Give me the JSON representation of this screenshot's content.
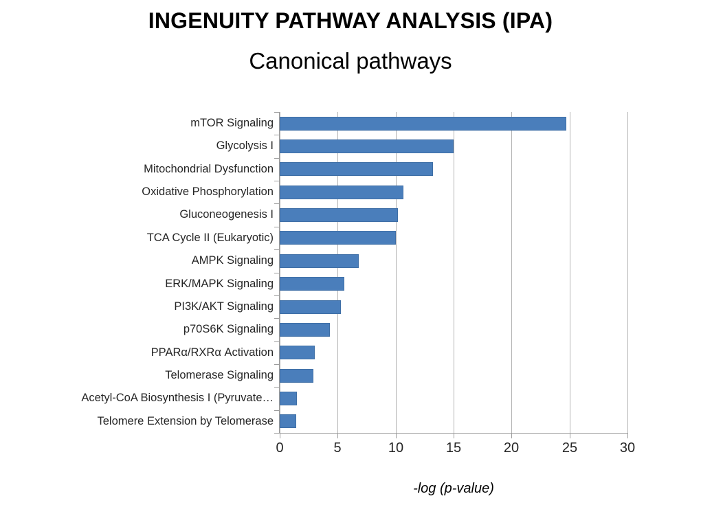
{
  "chart_data": {
    "type": "bar",
    "orientation": "horizontal",
    "title": "INGENUITY PATHWAY ANALYSIS (IPA)",
    "subtitle": "Canonical pathways",
    "xlabel": "-log (p-value)",
    "ylabel": "",
    "xlim": [
      0,
      30
    ],
    "xticks": [
      "0",
      "5",
      "10",
      "15",
      "20",
      "25",
      "30"
    ],
    "xtick_values": [
      0,
      5,
      10,
      15,
      20,
      25,
      30
    ],
    "grid": "vertical",
    "legend": "none",
    "bar_color": "#4a7ebb",
    "categories": [
      "mTOR Signaling",
      "Glycolysis I",
      "Mitochondrial Dysfunction",
      "Oxidative Phosphorylation",
      "Gluconeogenesis I",
      "TCA Cycle II (Eukaryotic)",
      "AMPK Signaling",
      "ERK/MAPK Signaling",
      "PI3K/AKT Signaling",
      "p70S6K Signaling",
      "PPARα/RXRα Activation",
      "Telomerase Signaling",
      "Acetyl-CoA Biosynthesis I (Pyruvate…",
      "Telomere Extension by Telomerase"
    ],
    "values": [
      24.7,
      15.0,
      13.2,
      10.7,
      10.2,
      10.0,
      6.8,
      5.6,
      5.3,
      4.3,
      3.0,
      2.9,
      1.5,
      1.4
    ]
  }
}
